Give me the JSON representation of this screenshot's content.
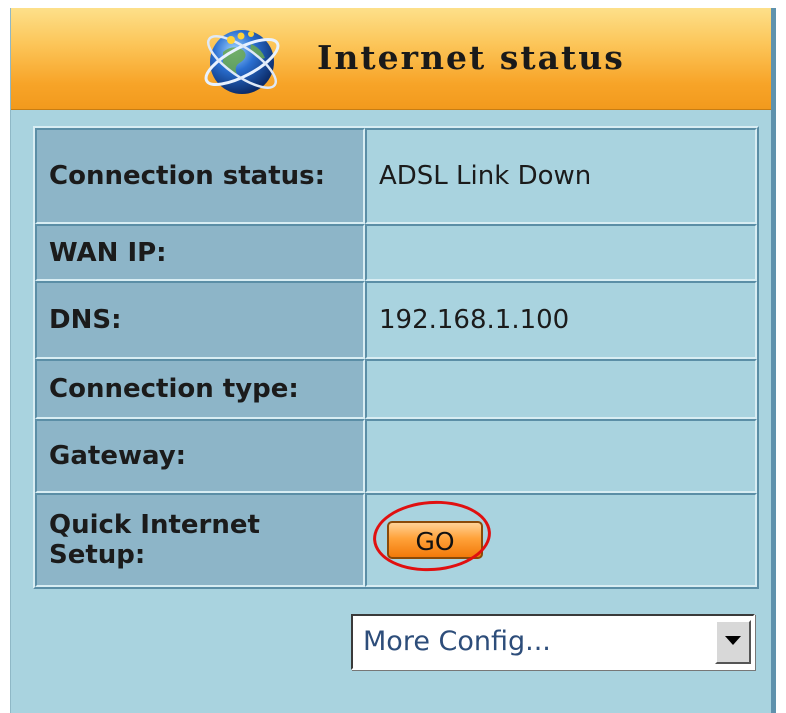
{
  "panel": {
    "title": "Internet status",
    "header_icon": "globe-network-icon"
  },
  "status_rows": [
    {
      "label": "Connection status:",
      "value": "ADSL Link Down"
    },
    {
      "label": "WAN IP:",
      "value": ""
    },
    {
      "label": "DNS:",
      "value": "192.168.1.100"
    },
    {
      "label": "Connection type:",
      "value": ""
    },
    {
      "label": "Gateway:",
      "value": ""
    },
    {
      "label": "Quick Internet Setup:",
      "value": ""
    }
  ],
  "quick_setup": {
    "button_label": "GO"
  },
  "more_config": {
    "selected": "More Config..."
  },
  "colors": {
    "header_orange": "#f7a428",
    "panel_blue": "#a9d3df",
    "label_cell_blue": "#8db5c8",
    "button_orange": "#ffa23a",
    "highlight_red": "#e01010"
  }
}
